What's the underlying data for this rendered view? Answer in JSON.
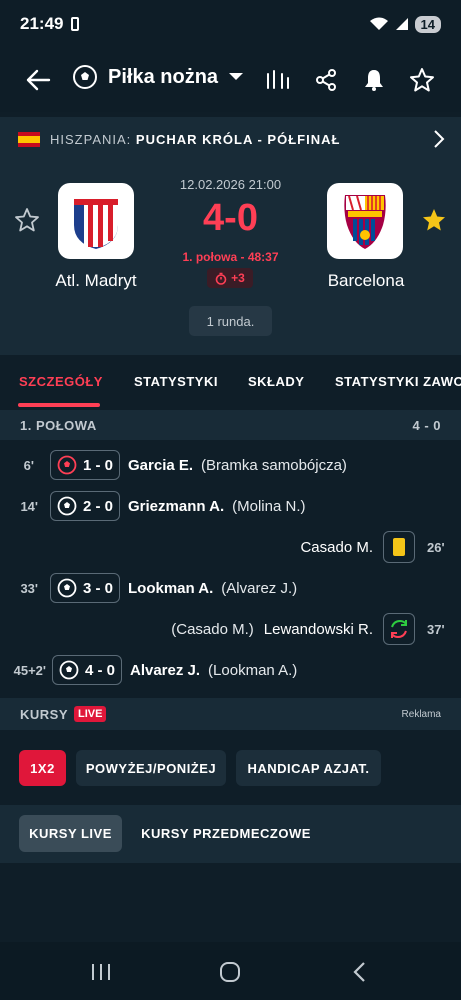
{
  "status_bar": {
    "time": "21:49",
    "battery": "14"
  },
  "app_bar": {
    "title": "Piłka nożna"
  },
  "league": {
    "country": "HISZPANIA:",
    "name": "PUCHAR KRÓLA - PÓŁFINAŁ"
  },
  "match": {
    "date": "12.02.2026 21:00",
    "score": "4-0",
    "period": "1. połowa - 48:37",
    "added_time": "+3",
    "round": "1 runda.",
    "home": {
      "name": "Atl. Madryt"
    },
    "away": {
      "name": "Barcelona"
    }
  },
  "tabs": [
    "SZCZEGÓŁY",
    "STATYSTYKI",
    "SKŁADY",
    "STATYSTYKI ZAWO"
  ],
  "section": {
    "title": "1. POŁOWA",
    "score": "4 - 0"
  },
  "events": [
    {
      "minute": "6'",
      "score": "1 - 0",
      "player": "Garcia E.",
      "note": "(Bramka samobójcza)"
    },
    {
      "minute": "14'",
      "score": "2 - 0",
      "player": "Griezmann A.",
      "note": "(Molina N.)"
    },
    {
      "minute": "26'",
      "player": "Casado M."
    },
    {
      "minute": "33'",
      "score": "3 - 0",
      "player": "Lookman A.",
      "note": "(Alvarez J.)"
    },
    {
      "minute": "37'",
      "player": "Lewandowski R.",
      "note": "(Casado M.)"
    },
    {
      "minute": "45+2'",
      "score": "4 - 0",
      "player": "Alvarez J.",
      "note": "(Lookman A.)"
    }
  ],
  "odds": {
    "title": "KURSY",
    "live": "LIVE",
    "ad": "Reklama",
    "chips": [
      "1X2",
      "POWYŻEJ/PONIŻEJ",
      "HANDICAP AZJAT."
    ],
    "subtabs": [
      "KURSY LIVE",
      "KURSY PRZEDMECZOWE"
    ]
  },
  "colors": {
    "accent": "#ff3f55",
    "background": "#0f1e28",
    "panel": "#182b37",
    "yellow_card": "#f5c518"
  }
}
